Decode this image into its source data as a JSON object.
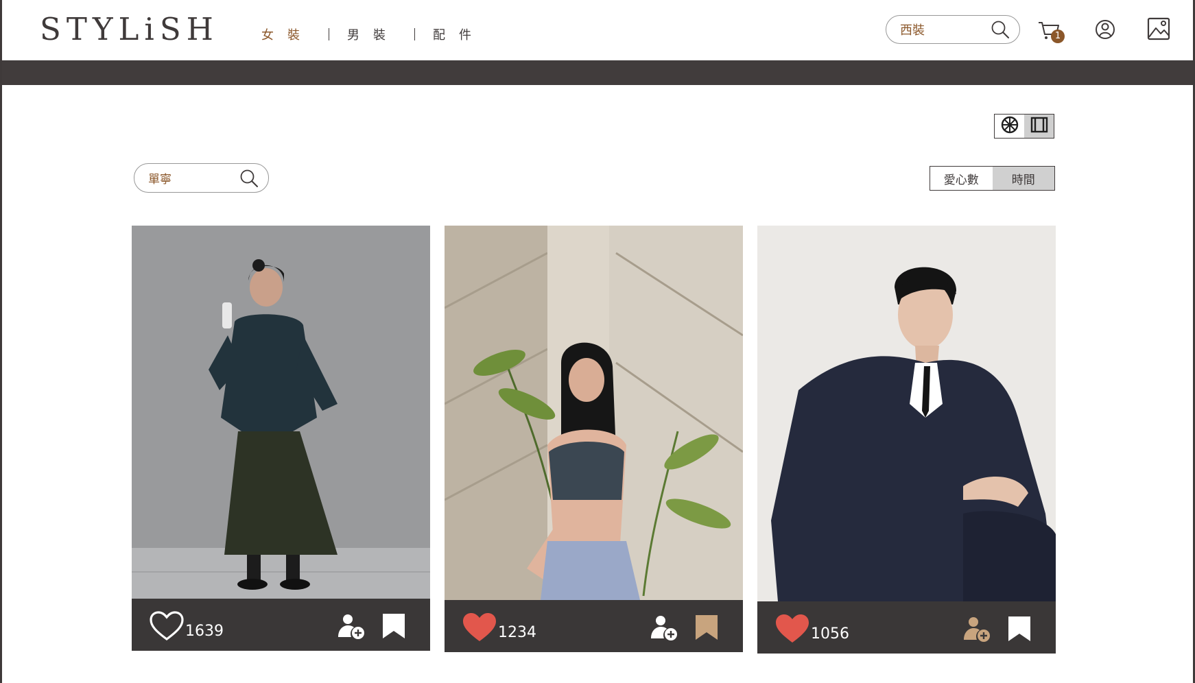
{
  "header": {
    "logo": "STYLiSH",
    "nav": [
      {
        "label": "女裝",
        "active": true
      },
      {
        "label": "男裝",
        "active": false
      },
      {
        "label": "配件",
        "active": false
      }
    ],
    "search_value": "西裝",
    "cart_count": "1",
    "icons": [
      "search-icon",
      "cart-icon",
      "member-icon",
      "gallery-icon"
    ]
  },
  "controls": {
    "view_toggle": [
      {
        "icon": "globe-icon",
        "active": true
      },
      {
        "icon": "filmstrip-icon",
        "active": false
      }
    ],
    "post_search_value": "單寧",
    "sort": [
      {
        "label": "愛心數",
        "active": true
      },
      {
        "label": "時間",
        "active": false
      }
    ]
  },
  "posts": [
    {
      "image": "woman-in-sweatshirt-and-skirt-photo",
      "liked": false,
      "likes": "1639",
      "follow_color": "#ffffff",
      "save_color": "#ffffff"
    },
    {
      "image": "woman-in-crop-top-photo",
      "liked": true,
      "likes": "1234",
      "follow_color": "#ffffff",
      "save_color": "#c8a47e"
    },
    {
      "image": "man-in-suit-photo",
      "liked": true,
      "likes": "1056",
      "follow_color": "#c8a47e",
      "save_color": "#ffffff"
    }
  ],
  "colors": {
    "brand_dark": "#3f3a3a",
    "accent_brown": "#8b572a",
    "heart_red": "#e2574c",
    "tan": "#c8a47e"
  }
}
